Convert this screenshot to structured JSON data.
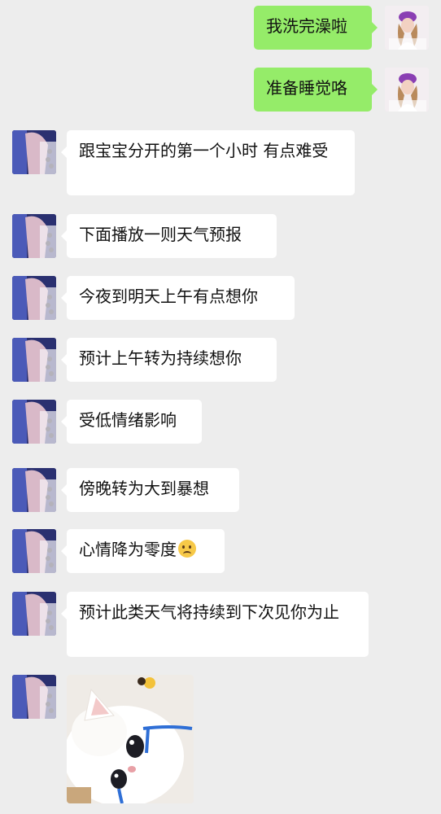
{
  "messages": [
    {
      "side": "out",
      "text": "我洗完澡啦"
    },
    {
      "side": "out",
      "text": "准备睡觉咯"
    },
    {
      "side": "in",
      "text": "跟宝宝分开的第一个小时 有点难受"
    },
    {
      "side": "in",
      "text": "下面播放一则天气预报"
    },
    {
      "side": "in",
      "text": "今夜到明天上午有点想你"
    },
    {
      "side": "in",
      "text": "预计上午转为持续想你"
    },
    {
      "side": "in",
      "text": "受低情绪影响"
    },
    {
      "side": "in",
      "text": "傍晚转为大到暴想"
    },
    {
      "side": "in",
      "text": "心情降为零度",
      "emoji": "frowning-face-icon"
    },
    {
      "side": "in",
      "text": "预计此类天气将持续到下次见你为止"
    },
    {
      "side": "in",
      "type": "image",
      "content": "cat-with-blue-tears-sticker"
    }
  ],
  "colors": {
    "background": "#ededed",
    "incoming_bubble": "#ffffff",
    "outgoing_bubble": "#95ec69"
  }
}
